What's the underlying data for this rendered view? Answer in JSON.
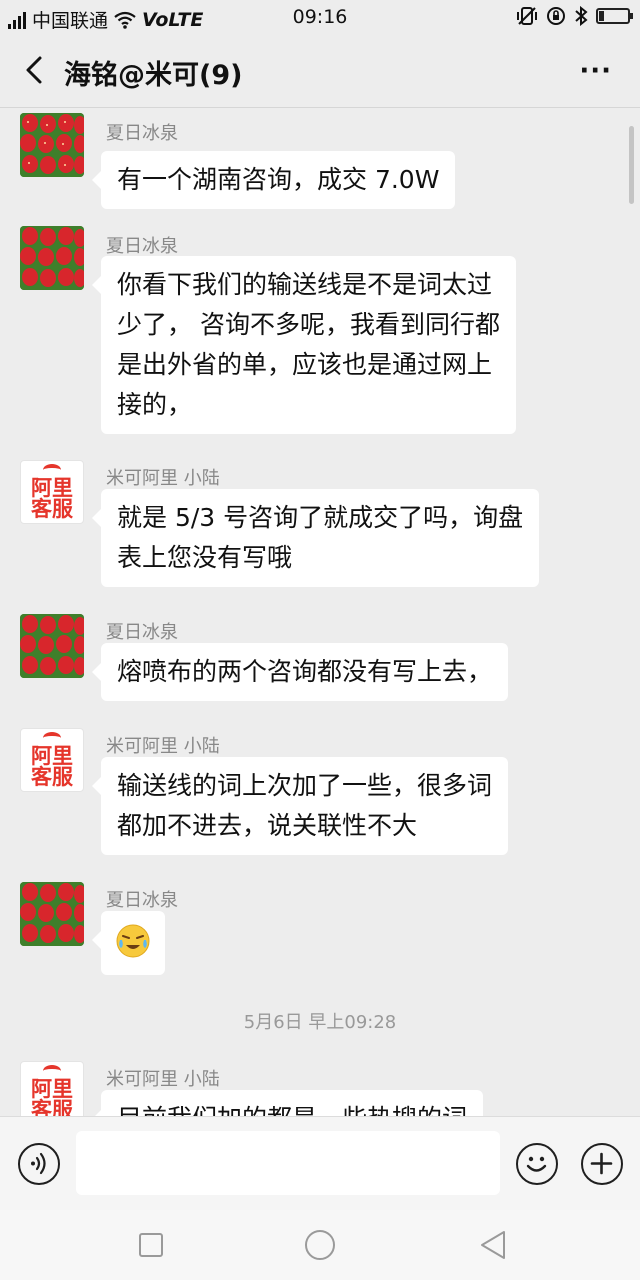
{
  "status_bar": {
    "carrier": "中国联通",
    "network": "VoLTE",
    "time": "09:16"
  },
  "header": {
    "title": "海铭@米可(9)",
    "back_icon": "chevron-left-icon",
    "more_label": "···"
  },
  "messages": [
    {
      "sender": "夏日冰泉",
      "avatar": "strawberry-avatar",
      "lines": [
        "有一个湖南咨询，成交 7.0W"
      ]
    },
    {
      "sender": "夏日冰泉",
      "avatar": "strawberry-avatar",
      "lines": [
        "你看下我们的输送线是不是词太过",
        "少了， 咨询不多呢，我看到同行都",
        "是出外省的单，应该也是通过网上",
        "接的，"
      ]
    },
    {
      "sender": "米可阿里 小陆",
      "avatar": "ali-kefu-avatar",
      "lines": [
        "就是 5/3 号咨询了就成交了吗，询盘",
        "表上您没有写哦"
      ]
    },
    {
      "sender": "夏日冰泉",
      "avatar": "strawberry-avatar",
      "lines": [
        "熔喷布的两个咨询都没有写上去，"
      ]
    },
    {
      "sender": "米可阿里 小陆",
      "avatar": "ali-kefu-avatar",
      "lines": [
        "输送线的词上次加了一些，很多词",
        "都加不进去，说关联性不大"
      ]
    },
    {
      "sender": "夏日冰泉",
      "avatar": "strawberry-avatar",
      "emoji": "crying-laughing-emoji"
    },
    {
      "sender": "米可阿里 小陆",
      "avatar": "ali-kefu-avatar",
      "lines": [
        "目前我们加的都是一些热搜的词"
      ]
    }
  ],
  "kefu_logo": {
    "line1": "阿里",
    "line2": "客服"
  },
  "timestamp": "5月6日 早上09:28",
  "input_bar": {
    "placeholder": "",
    "voice_icon": "voice-icon",
    "emoji_icon": "emoji-icon",
    "plus_icon": "plus-icon"
  },
  "colors": {
    "background": "#ededed",
    "bubble": "#ffffff",
    "sender_text": "#888888",
    "kefu_red": "#e5352b"
  }
}
